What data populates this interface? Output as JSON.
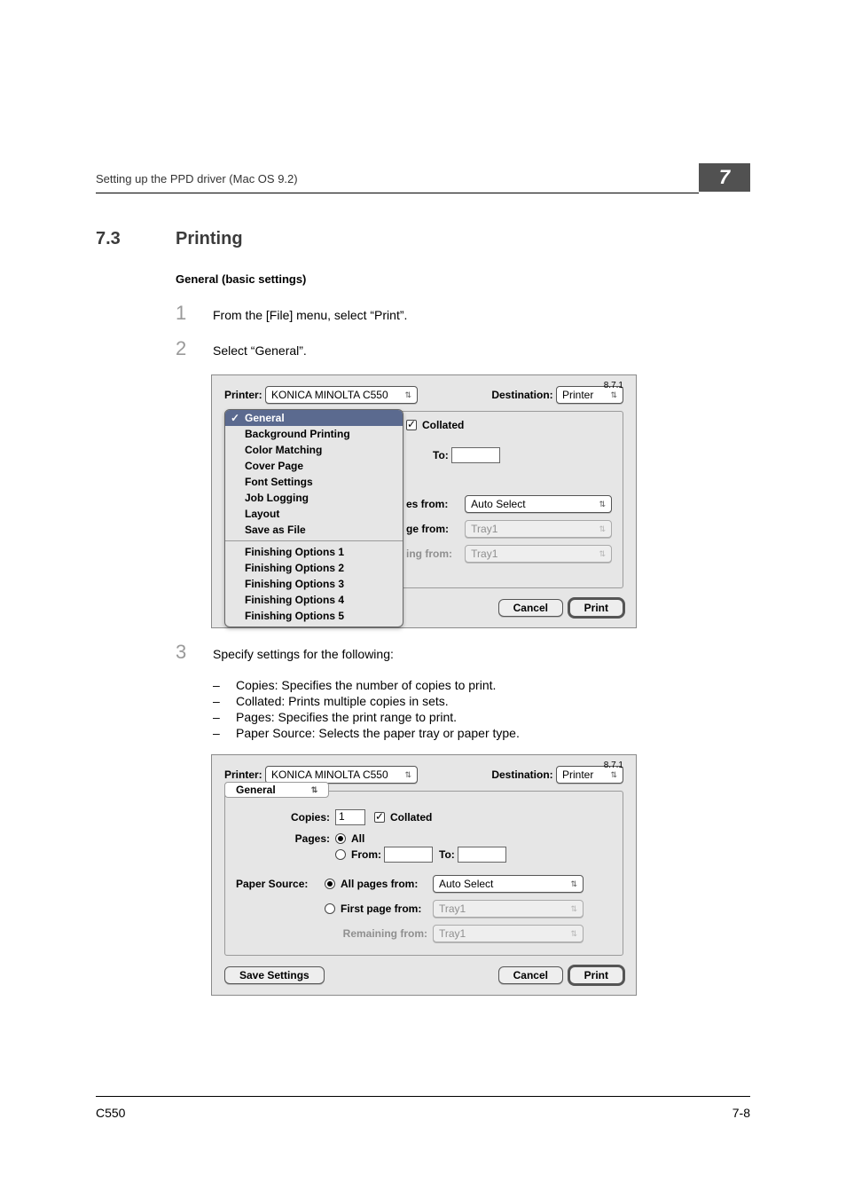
{
  "header": {
    "running_head": "Setting up the PPD driver (Mac OS 9.2)",
    "chapter_number": "7"
  },
  "section": {
    "number": "7.3",
    "title": "Printing",
    "subhead": "General (basic settings)"
  },
  "steps": {
    "s1": {
      "num": "1",
      "text": "From the [File] menu, select “Print”."
    },
    "s2": {
      "num": "2",
      "text": "Select “General”."
    },
    "s3": {
      "num": "3",
      "text": "Specify settings for the following:"
    }
  },
  "bullets": {
    "b0": "Copies: Specifies the number of copies to print.",
    "b1": "Collated: Prints multiple copies in sets.",
    "b2": "Pages: Specifies the print range to print.",
    "b3": "Paper Source: Selects the paper tray or paper type."
  },
  "dialog_common": {
    "version": "8.7.1",
    "printer_label": "Printer:",
    "printer_value": "KONICA MINOLTA C550",
    "destination_label": "Destination:",
    "destination_value": "Printer",
    "save_settings": "Save Settings",
    "cancel": "Cancel",
    "print": "Print"
  },
  "dialog1": {
    "popup": {
      "general": "General",
      "bg_printing": "Background Printing",
      "color_matching": "Color Matching",
      "cover_page": "Cover Page",
      "font_settings": "Font Settings",
      "job_logging": "Job Logging",
      "layout": "Layout",
      "save_as_file": "Save as File",
      "fin1": "Finishing Options 1",
      "fin2": "Finishing Options 2",
      "fin3": "Finishing Options 3",
      "fin4": "Finishing Options 4",
      "fin5": "Finishing Options 5"
    },
    "collated_label": "Collated",
    "to_label": "To:",
    "row_es_from": "es from:",
    "row_ge_from": "ge from:",
    "row_ing_from": "ing from:",
    "auto_select": "Auto Select",
    "tray1": "Tray1"
  },
  "dialog2": {
    "tab": "General",
    "copies_label": "Copies:",
    "copies_value": "1",
    "collated_label": "Collated",
    "pages_label": "Pages:",
    "pages_all": "All",
    "pages_from": "From:",
    "to_label": "To:",
    "paper_source_label": "Paper Source:",
    "all_pages_from": "All pages from:",
    "first_page_from": "First page from:",
    "remaining_from": "Remaining from:",
    "auto_select": "Auto Select",
    "tray1": "Tray1"
  },
  "footer": {
    "model": "C550",
    "page": "7-8"
  }
}
